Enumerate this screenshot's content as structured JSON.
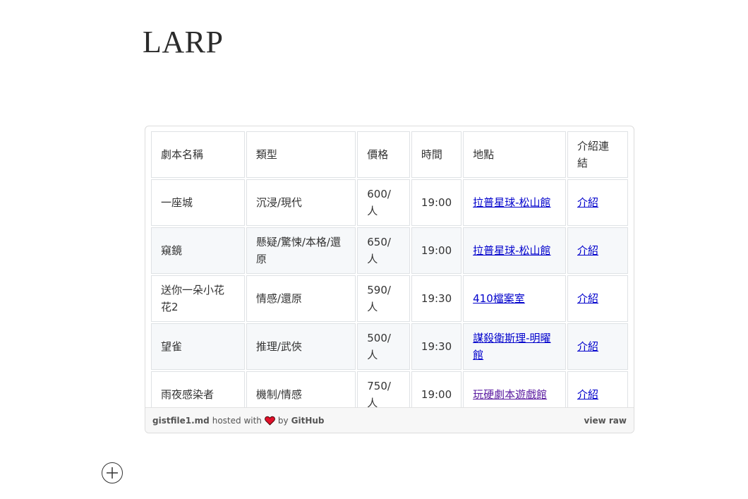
{
  "page": {
    "title": "LARP"
  },
  "table": {
    "headers": [
      "劇本名稱",
      "類型",
      "價格",
      "時間",
      "地點",
      "介紹連結"
    ],
    "rows": [
      {
        "name": "一座城",
        "genre": "沉浸/現代",
        "price": "600/人",
        "time": "19:00",
        "venue": "拉普星球-松山館",
        "link": "介紹"
      },
      {
        "name": "窺鏡",
        "genre": "懸疑/驚悚/本格/還原",
        "price": "650/人",
        "time": "19:00",
        "venue": "拉普星球-松山館",
        "link": "介紹"
      },
      {
        "name": "送你一朵小花花2",
        "genre": "情感/還原",
        "price": "590/人",
        "time": "19:30",
        "venue": "410檔案室",
        "link": "介紹"
      },
      {
        "name": "望雀",
        "genre": "推理/武俠",
        "price": "500/人",
        "time": "19:30",
        "venue": "謀殺衛斯理-明曜館",
        "link": "介紹"
      },
      {
        "name": "雨夜感染者",
        "genre": "機制/情感",
        "price": "750/人",
        "time": "19:00",
        "venue": "玩硬劇本遊戲館",
        "link": "介紹"
      }
    ]
  },
  "gist_meta": {
    "filename": "gistfile1.md",
    "hosted_with": "hosted with",
    "by": "by",
    "host": "GitHub",
    "view_raw": "view raw"
  },
  "colors": {
    "link": "#0000cc",
    "visited_link": "#5a1aa0",
    "heart": "#e0102a",
    "row_alt_bg": "#f6f8fa"
  },
  "icons": {
    "heart": "heart-icon",
    "add": "plus-circle-icon"
  }
}
